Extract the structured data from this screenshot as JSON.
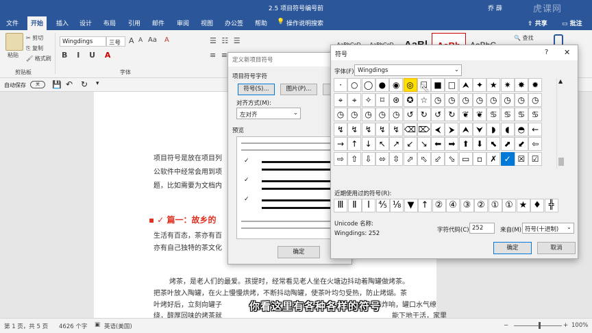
{
  "titlebar": {
    "title": "2.5 项目符号编号前",
    "user": "乔 薛",
    "watermark": "虎课网"
  },
  "menu": {
    "tabs": [
      "文件",
      "开始",
      "插入",
      "设计",
      "布局",
      "引用",
      "邮件",
      "审阅",
      "视图",
      "办公签",
      "帮助",
      "操作说明搜索"
    ],
    "active": "开始",
    "share": "共享",
    "comment": "批注"
  },
  "ribbon": {
    "paste": "粘贴",
    "cut": "剪切",
    "copy": "复制",
    "format_painter": "格式刷",
    "clipboard": "剪贴板",
    "font_name": "Wingdings",
    "font_size": "三号",
    "font_group": "字体",
    "styles": [
      "AaBbCcD",
      "AaBbCcD",
      "AaBl",
      "AaBb",
      "AaBbC"
    ],
    "find": "查找",
    "replace": "替换",
    "grow": "A",
    "shrink": "A",
    "change_case": "Aa",
    "clear": "A"
  },
  "qat": {
    "autosave": "自动保存",
    "autosave_state": "关"
  },
  "document": {
    "lines": [
      "项目符号是放在项目列",
      "公软件中经常会用到项",
      "题，比如需要为文档内",
      "篇一：故乡的",
      "生活有百态，茶亦有百",
      "亦有自己独特的茶文化",
      "烤茶，是老人们的最爱。孩提时，经常看见老人坐在火塘边抖动着陶罐做烤茶。",
      "把茶叶放入陶罐，在火上慢慢烘烤，不断抖动陶罐，使茶叶均匀受热，防止烤煳。茶",
      "叶烤好后，立刻向罐子",
      "绕，醇厚回味的烤茶就",
      "阵炸响，罐口水气缭",
      "能下地干活，家里"
    ]
  },
  "dialog_bullet": {
    "title": "定义新项目符号",
    "section": "项目符号字符",
    "symbol_btn": "符号(S)...",
    "picture_btn": "图片(P)...",
    "align_label": "对齐方式(M):",
    "align_value": "左对齐",
    "preview_label": "预览",
    "ok": "确定"
  },
  "dialog_symbol": {
    "title": "符号",
    "font_label": "字体(F):",
    "font_value": "Wingdings",
    "grid": [
      [
        "·",
        "○",
        "◯",
        "●",
        "◉",
        "◎",
        "☐",
        "■",
        "□",
        "⮝",
        "✦",
        "★",
        "✷",
        "✸",
        "✹"
      ],
      [
        "⌖",
        "⌖",
        "✧",
        "⌑",
        "⊛",
        "✪",
        "☆",
        "◷",
        "◷",
        "◷",
        "◷",
        "◷",
        "◷",
        "◷",
        "◷"
      ],
      [
        "◷",
        "◷",
        "◷",
        "◷",
        "◷",
        "↺",
        "↻",
        "↺",
        "↻",
        "❦",
        "❦",
        "♋",
        "♋",
        "♋",
        "♋"
      ],
      [
        "↯",
        "↯",
        "↯",
        "↯",
        "↯",
        "⌫",
        "⌦",
        "⮜",
        "⮞",
        "⮝",
        "⮟",
        "◗",
        "◖",
        "◓",
        "←"
      ],
      [
        "→",
        "↑",
        "↓",
        "↖",
        "↗",
        "↙",
        "↘",
        "⬅",
        "➡",
        "⬆",
        "⬇",
        "⬉",
        "⬈",
        "⬋",
        "⇦"
      ],
      [
        "⇨",
        "⇧",
        "⇩",
        "⬄",
        "⇳",
        "⬀",
        "⬁",
        "⬃",
        "⬂",
        "▭",
        "▫",
        "✗",
        "✓",
        "☒",
        "☑"
      ]
    ],
    "recent_label": "近期使用过的符号(R):",
    "recent": [
      "Ⅲ",
      "Ⅱ",
      "Ⅰ",
      "⅘",
      "⅛",
      "▼",
      "↑",
      "②",
      "④",
      "③",
      "②",
      "①",
      "①",
      "★",
      "♦",
      "╬"
    ],
    "unicode_name_label": "Unicode 名称:",
    "unicode_name_value": "Wingdings: 252",
    "char_code_label": "字符代码(C):",
    "char_code_value": "252",
    "from_label": "来自(M):",
    "from_value": "符号(十进制)",
    "ok": "确定",
    "cancel": "取消"
  },
  "status": {
    "page": "第 1 页，共 5 页",
    "words": "4626 个字",
    "lang": "英语(美国)",
    "zoom": "100%"
  },
  "subtitle": "你看这里有各种各样的符号"
}
